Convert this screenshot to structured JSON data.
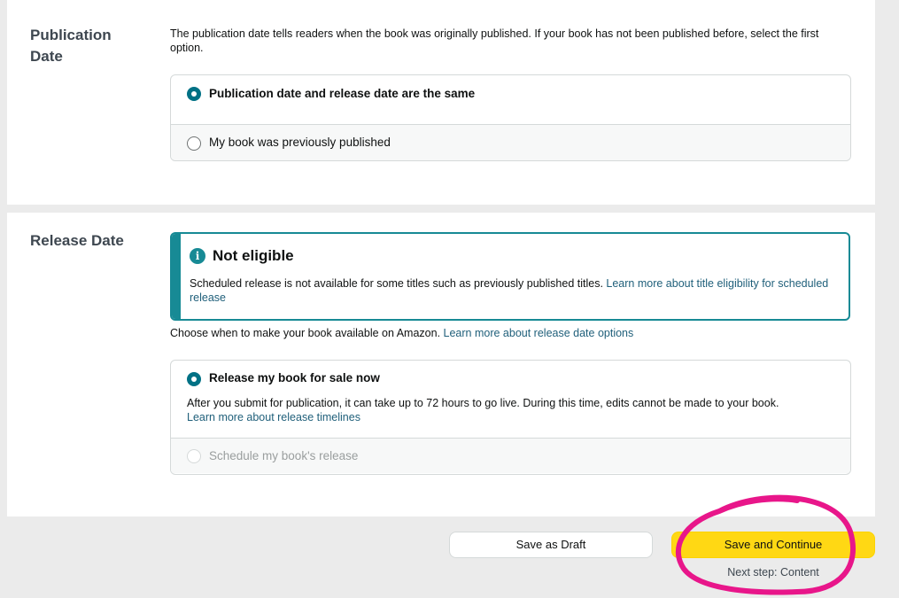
{
  "publication_date": {
    "title": "Publication\nDate",
    "description": "The publication date tells readers when the book was originally published. If your book has not been published before, select the first option.",
    "options": [
      {
        "label": "Publication date and release date are the same",
        "selected": true
      },
      {
        "label": "My book was previously published",
        "selected": false
      }
    ]
  },
  "release_date": {
    "title": "Release Date",
    "alert": {
      "icon": "info-icon",
      "title": "Not eligible",
      "body": "Scheduled release is not available for some titles such as previously published titles. ",
      "link": "Learn more about title eligibility for scheduled release"
    },
    "intro": "Choose when to make your book available on Amazon. ",
    "intro_link": "Learn more about release date options",
    "options": [
      {
        "label": "Release my book for sale now",
        "selected": true,
        "description": "After you submit for publication, it can take up to 72 hours to go live. During this time, edits cannot be made to your book.",
        "link": "Learn more about release timelines"
      },
      {
        "label": "Schedule my book's release",
        "selected": false,
        "disabled": true
      }
    ]
  },
  "footer": {
    "save_draft": "Save as Draft",
    "save_continue": "Save and Continue",
    "next_step": "Next step: Content"
  },
  "colors": {
    "accent": "#007185",
    "primary_button": "#ffd814",
    "annotation": "#e8168a"
  }
}
